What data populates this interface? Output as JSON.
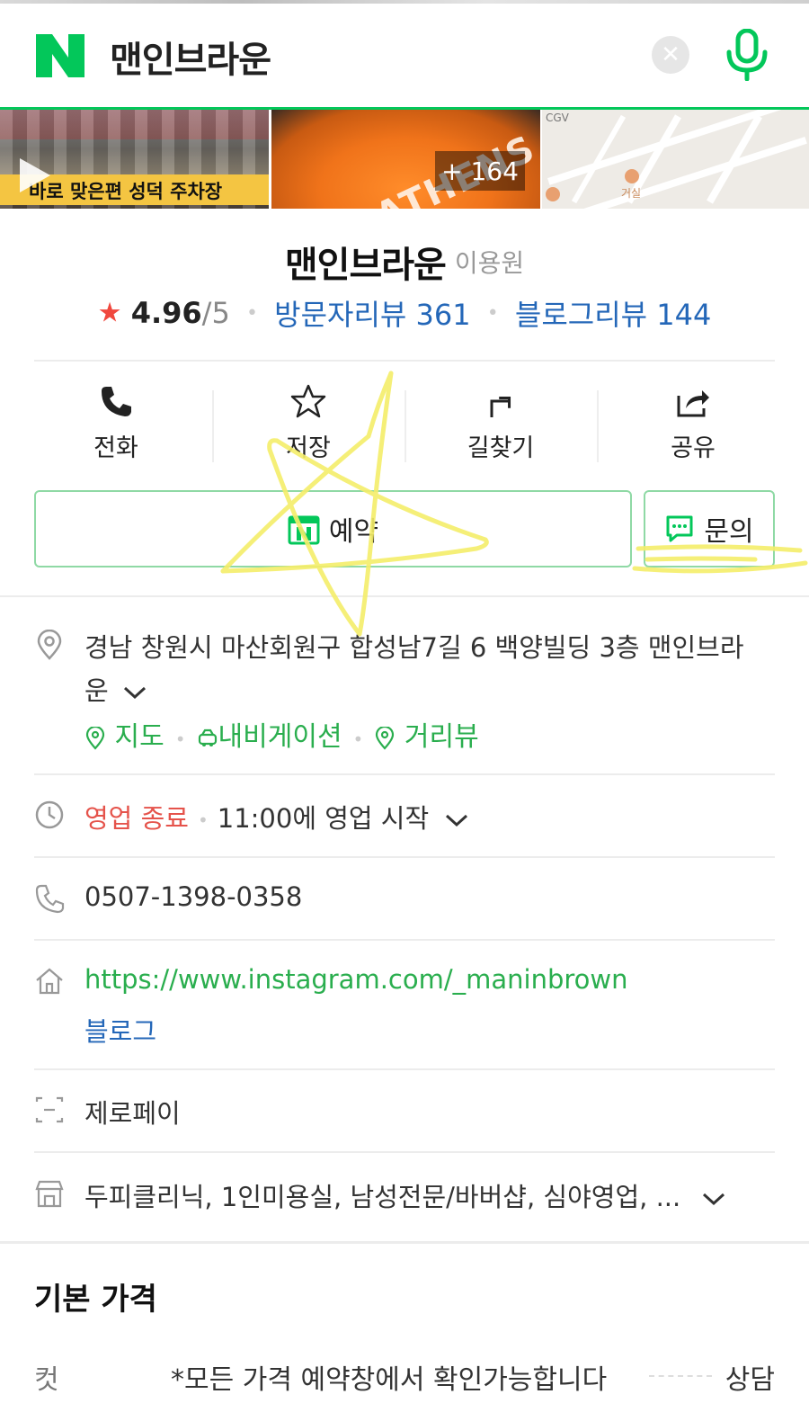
{
  "header": {
    "logo": "N",
    "query": "맨인브라운",
    "clear_icon": "close-icon",
    "mic_icon": "microphone-icon"
  },
  "photos": {
    "video_caption": "바로 맞은편 성덕 주차장",
    "photo_more": "+ 164",
    "map_label_top": "CGV",
    "map_label_bottom": "거실"
  },
  "place": {
    "name": "맨인브라운",
    "category": "이용원",
    "rating": "4.96",
    "rating_max": "/5",
    "visitor_reviews": "방문자리뷰 361",
    "blog_reviews": "블로그리뷰 144"
  },
  "actions": [
    {
      "label": "전화",
      "icon": "phone-icon"
    },
    {
      "label": "저장",
      "icon": "star-icon"
    },
    {
      "label": "길찾기",
      "icon": "directions-icon"
    },
    {
      "label": "공유",
      "icon": "share-icon"
    }
  ],
  "buttons": {
    "reserve": "예약",
    "inquiry": "문의"
  },
  "info": {
    "address_line1": "경남 창원시 마산회원구 합성남7길 6 백양빌딩 3층 맨인브라",
    "address_line2": "운",
    "map_link": "지도",
    "navi_link": "내비게이션",
    "street_link": "거리뷰",
    "status": "영업 종료",
    "hours": "11:00에 영업 시작",
    "phone": "0507-1398-0358",
    "website": "https://www.instagram.com/_maninbrown",
    "blog": "블로그",
    "payment": "제로페이",
    "services": "두피클리닉, 1인미용실, 남성전문/바버샵, 심야영업, ..."
  },
  "prices": {
    "title": "기본 가격",
    "items": [
      {
        "name": "컷",
        "desc": "*모든 가격 예약창에서 확인가능합니다",
        "price": "상담"
      }
    ]
  },
  "colors": {
    "naver_green": "#03c75a",
    "link_blue": "#2467b8",
    "closed_red": "#e5534b",
    "star_red": "#f0483e",
    "scribble_yellow": "#f5ee6a"
  }
}
